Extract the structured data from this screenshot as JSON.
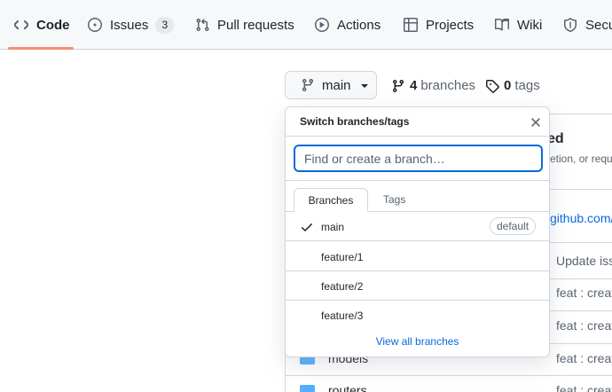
{
  "nav": {
    "tabs": [
      {
        "label": "Code",
        "icon": "code-icon"
      },
      {
        "label": "Issues",
        "icon": "issue-icon",
        "count": "3"
      },
      {
        "label": "Pull requests",
        "icon": "pull-request-icon"
      },
      {
        "label": "Actions",
        "icon": "play-icon"
      },
      {
        "label": "Projects",
        "icon": "table-icon"
      },
      {
        "label": "Wiki",
        "icon": "book-icon"
      },
      {
        "label": "Secu",
        "icon": "shield-icon"
      }
    ],
    "active_underline_color": "#fd8c73"
  },
  "repo": {
    "branch_button_label": "main",
    "branches_count": "4",
    "branches_label": "branches",
    "tags_count": "0",
    "tags_label": "tags"
  },
  "background": {
    "heading_fragment": "ed",
    "desc_fragment": "etion, or requ",
    "link_fragment": "github.com/",
    "files": [
      {
        "name": "",
        "commit": "Update iss"
      },
      {
        "name": "",
        "commit": "feat : creat"
      },
      {
        "name": "",
        "commit": "feat : creat"
      },
      {
        "name": "models",
        "commit": "feat : creat"
      },
      {
        "name": "routers",
        "commit": "feat : creat"
      }
    ]
  },
  "dropdown": {
    "title": "Switch branches/tags",
    "search_placeholder": "Find or create a branch…",
    "tabs": {
      "branches": "Branches",
      "tags": "Tags"
    },
    "items": [
      {
        "label": "main",
        "selected": true,
        "badge": "default"
      },
      {
        "label": "feature/1"
      },
      {
        "label": "feature/2"
      },
      {
        "label": "feature/3"
      }
    ],
    "footer_link": "View all branches"
  },
  "colors": {
    "accent_blue": "#0969da",
    "folder": "#54aeff"
  }
}
